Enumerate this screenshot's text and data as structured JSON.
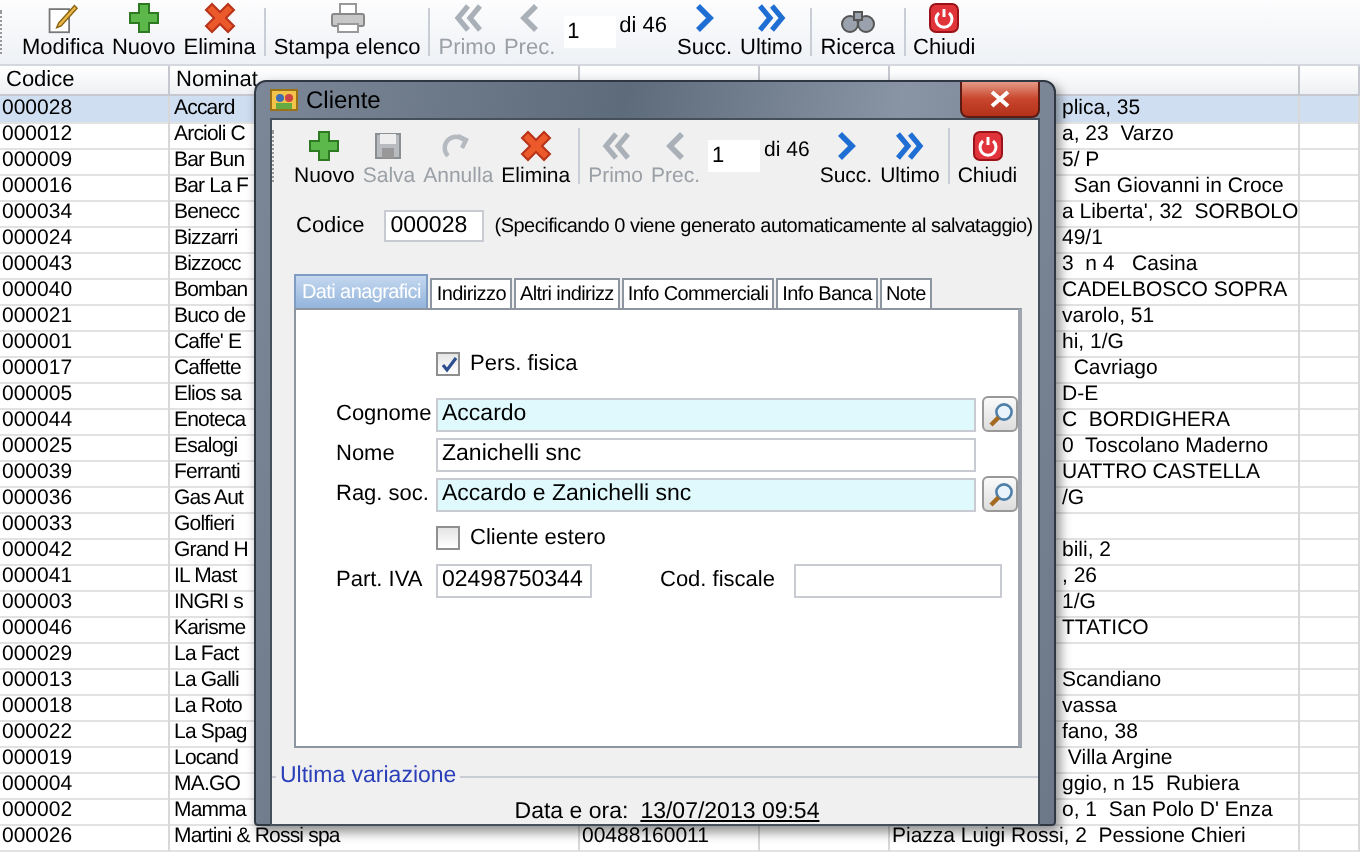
{
  "toolbar": {
    "groups": [
      {
        "items": [
          {
            "kind": "button",
            "label": "Modifica",
            "disabled": false
          },
          {
            "kind": "button",
            "label": "Nuovo",
            "disabled": false
          },
          {
            "kind": "button",
            "label": "Elimina",
            "disabled": false
          }
        ]
      },
      {
        "items": [
          {
            "kind": "button",
            "label": "Stampa elenco",
            "disabled": false
          }
        ]
      },
      {
        "items": [
          {
            "kind": "button",
            "label": "Primo",
            "disabled": true
          },
          {
            "kind": "button",
            "label": "Prec.",
            "disabled": true
          },
          {
            "kind": "field",
            "value": "1"
          },
          {
            "kind": "text",
            "label": "di 46"
          },
          {
            "kind": "button",
            "label": "Succ.",
            "disabled": false
          },
          {
            "kind": "button",
            "label": "Ultimo",
            "disabled": false
          }
        ]
      },
      {
        "items": [
          {
            "kind": "button",
            "label": "Ricerca",
            "disabled": false
          }
        ]
      },
      {
        "items": [
          {
            "kind": "button",
            "label": "Chiudi",
            "disabled": false
          }
        ]
      }
    ]
  },
  "table": {
    "columns": [
      "Codice",
      "Nominat"
    ],
    "rows": [
      {
        "codice": "000028",
        "nominativo": "Accard",
        "indirizzo": "plica, 35",
        "selected": true
      },
      {
        "codice": "000012",
        "nominativo": "Arcioli C",
        "indirizzo": "a, 23  Varzo",
        "selected": false
      },
      {
        "codice": "000009",
        "nominativo": "Bar Bun",
        "indirizzo": "5/ P",
        "selected": false
      },
      {
        "codice": "000016",
        "nominativo": "Bar La F",
        "indirizzo": "  San Giovanni in Croce",
        "selected": false
      },
      {
        "codice": "000034",
        "nominativo": "Benecc",
        "indirizzo": "a Liberta', 32  SORBOLO",
        "selected": false
      },
      {
        "codice": "000024",
        "nominativo": "Bizzarri",
        "indirizzo": "49/1",
        "selected": false
      },
      {
        "codice": "000043",
        "nominativo": "Bizzocc",
        "indirizzo": "3  n 4   Casina",
        "selected": false
      },
      {
        "codice": "000040",
        "nominativo": "Bomban",
        "indirizzo": "CADELBOSCO SOPRA",
        "selected": false
      },
      {
        "codice": "000021",
        "nominativo": "Buco de",
        "indirizzo": "varolo, 51",
        "selected": false
      },
      {
        "codice": "000001",
        "nominativo": "Caffe' E",
        "indirizzo": "hi, 1/G",
        "selected": false
      },
      {
        "codice": "000017",
        "nominativo": "Caffette",
        "indirizzo": "  Cavriago",
        "selected": false
      },
      {
        "codice": "000005",
        "nominativo": "Elios sa",
        "indirizzo": "D-E",
        "selected": false
      },
      {
        "codice": "000044",
        "nominativo": "Enoteca",
        "indirizzo": "C  BORDIGHERA",
        "selected": false
      },
      {
        "codice": "000025",
        "nominativo": "Esalogi",
        "indirizzo": "0  Toscolano Maderno",
        "selected": false
      },
      {
        "codice": "000039",
        "nominativo": "Ferranti",
        "indirizzo": "UATTRO CASTELLA",
        "selected": false
      },
      {
        "codice": "000036",
        "nominativo": "Gas Aut",
        "indirizzo": "/G",
        "selected": false
      },
      {
        "codice": "000033",
        "nominativo": "Golfieri",
        "selected": false
      },
      {
        "codice": "000042",
        "nominativo": "Grand H",
        "indirizzo": "bili, 2",
        "selected": false
      },
      {
        "codice": "000041",
        "nominativo": "IL Mast",
        "indirizzo": ", 26",
        "selected": false
      },
      {
        "codice": "000003",
        "nominativo": "INGRI s",
        "indirizzo": "1/G",
        "selected": false
      },
      {
        "codice": "000046",
        "nominativo": "Karisme",
        "indirizzo": "TTATICO",
        "selected": false
      },
      {
        "codice": "000029",
        "nominativo": "La Fact",
        "selected": false
      },
      {
        "codice": "000013",
        "nominativo": "La Galli",
        "indirizzo": "Scandiano",
        "selected": false
      },
      {
        "codice": "000018",
        "nominativo": "La Roto",
        "indirizzo": "vassa",
        "selected": false
      },
      {
        "codice": "000022",
        "nominativo": "La Spag",
        "indirizzo": "fano, 38",
        "selected": false
      },
      {
        "codice": "000019",
        "nominativo": "Locand",
        "indirizzo": " Villa Argine",
        "selected": false
      },
      {
        "codice": "000004",
        "nominativo": "MA.GO",
        "indirizzo": "ggio, n 15  Rubiera",
        "selected": false
      },
      {
        "codice": "000002",
        "nominativo": "Mamma",
        "indirizzo": "o, 1  San Polo D' Enza",
        "selected": false
      },
      {
        "codice": "000026",
        "nominativo": "Martini & Rossi spa",
        "part_iva": "00488160011",
        "indirizzo": "Piazza Luigi Rossi, 2  Pessione Chieri",
        "selected": false
      }
    ]
  },
  "dialog": {
    "title": "Cliente",
    "toolbar": {
      "groups": [
        {
          "items": [
            {
              "kind": "button",
              "label": "Nuovo",
              "disabled": false
            },
            {
              "kind": "button",
              "label": "Salva",
              "disabled": true
            },
            {
              "kind": "button",
              "label": "Annulla",
              "disabled": true
            },
            {
              "kind": "button",
              "label": "Elimina",
              "disabled": false
            }
          ]
        },
        {
          "items": [
            {
              "kind": "button",
              "label": "Primo",
              "disabled": true
            },
            {
              "kind": "button",
              "label": "Prec.",
              "disabled": true
            },
            {
              "kind": "field",
              "value": "1"
            },
            {
              "kind": "text",
              "label": "di 46"
            },
            {
              "kind": "button",
              "label": "Succ.",
              "disabled": false
            },
            {
              "kind": "button",
              "label": "Ultimo",
              "disabled": false
            }
          ]
        },
        {
          "items": [
            {
              "kind": "button",
              "label": "Chiudi",
              "disabled": false
            }
          ]
        }
      ]
    },
    "codice": {
      "label": "Codice",
      "value": "000028",
      "hint": "(Specificando 0 viene generato automaticamente al salvataggio)"
    },
    "tabs": [
      {
        "label": "Dati anagrafici",
        "selected": true
      },
      {
        "label": "Indirizzo",
        "selected": false
      },
      {
        "label": "Altri indirizz",
        "selected": false
      },
      {
        "label": "Info Commerciali",
        "selected": false
      },
      {
        "label": "Info Banca",
        "selected": false
      },
      {
        "label": "Note",
        "selected": false
      }
    ],
    "pers_fisica": {
      "label": "Pers. fisica",
      "checked": true
    },
    "fields": [
      {
        "label": "Cognome",
        "value": "Accardo",
        "lookup": true
      },
      {
        "label": "Nome",
        "value": "Zanichelli snc",
        "lookup": false
      },
      {
        "label": "Rag. soc.",
        "value": "Accardo e Zanichelli snc",
        "lookup": true
      }
    ],
    "cliente_estero": {
      "label": "Cliente estero",
      "checked": false
    },
    "part_iva": {
      "label": "Part. IVA",
      "value": "02498750344"
    },
    "cod_fiscale": {
      "label": "Cod. fiscale"
    },
    "last_change": {
      "legend": "Ultima variazione",
      "label": "Data e ora:",
      "value": "13/07/2013 09:54"
    }
  }
}
